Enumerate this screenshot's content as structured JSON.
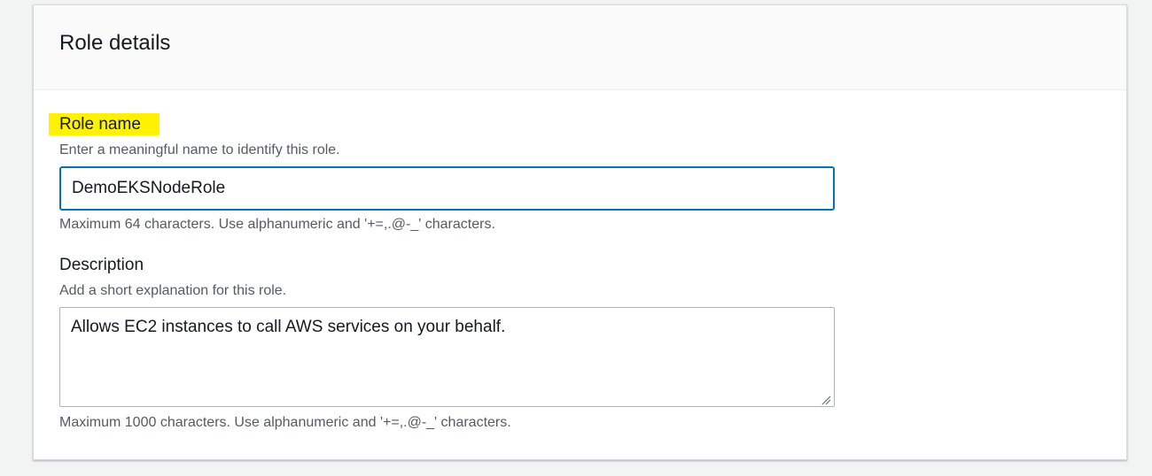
{
  "role_details": {
    "title": "Role details",
    "role_name": {
      "label": "Role name",
      "description": "Enter a meaningful name to identify this role.",
      "value": "DemoEKSNodeRole",
      "constraint": "Maximum 64 characters. Use alphanumeric and '+=,.@-_' characters."
    },
    "description_field": {
      "label": "Description",
      "description": "Add a short explanation for this role.",
      "value": "Allows EC2 instances to call AWS services on your behalf.",
      "constraint": "Maximum 1000 characters. Use alphanumeric and '+=,.@-_' characters."
    }
  },
  "colors": {
    "highlight": "#fff200",
    "focus_border": "#0073bb",
    "hint_text": "#545b64",
    "body_text": "#16191f"
  }
}
